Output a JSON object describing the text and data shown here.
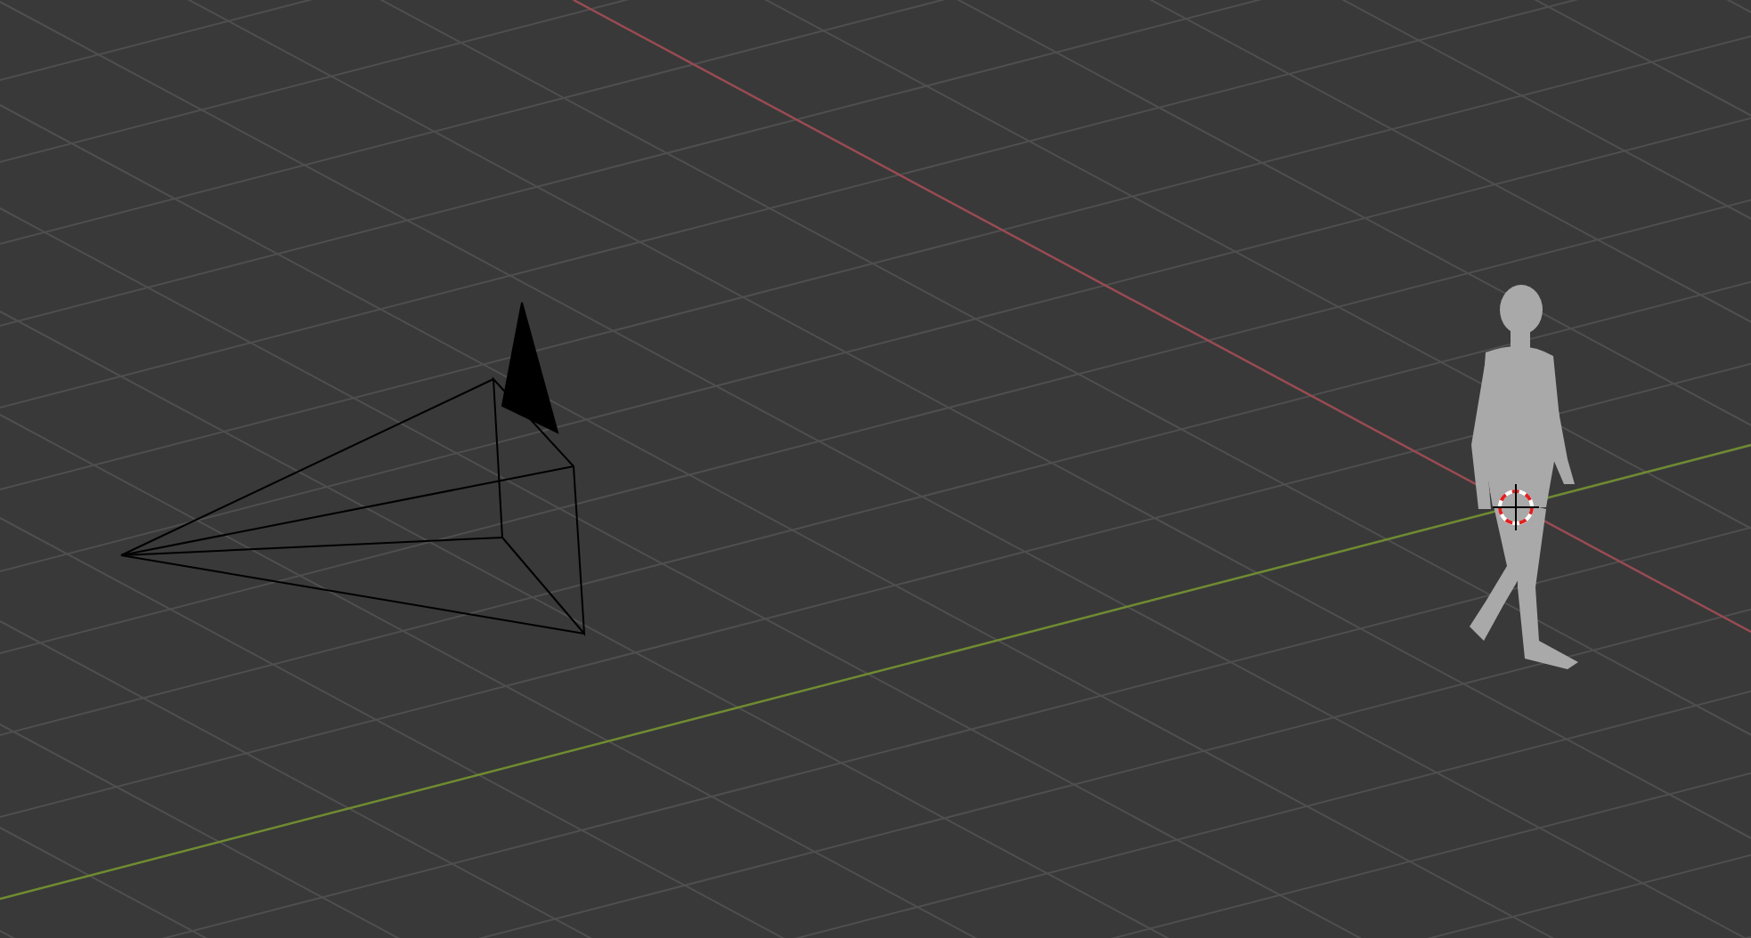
{
  "viewport": {
    "objects": [
      {
        "kind": "grid"
      },
      {
        "kind": "camera"
      },
      {
        "kind": "mannequin"
      },
      {
        "kind": "cursor"
      }
    ]
  }
}
